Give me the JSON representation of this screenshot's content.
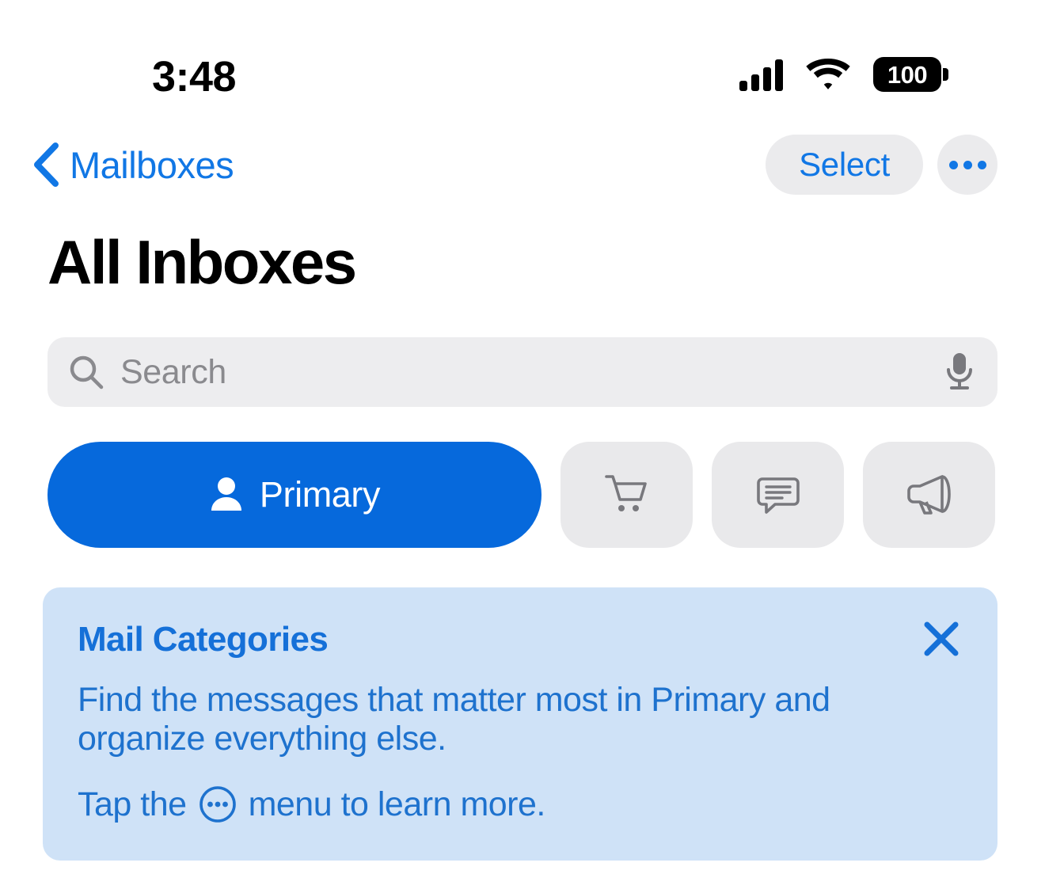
{
  "status_bar": {
    "time": "3:48",
    "battery_level": "100",
    "signal_icon": "cellular-signal-icon",
    "wifi_icon": "wifi-icon",
    "battery_icon": "battery-icon"
  },
  "nav": {
    "back_label": "Mailboxes",
    "back_icon": "chevron-left-icon",
    "select_label": "Select",
    "more_icon": "ellipsis-icon"
  },
  "header": {
    "title": "All Inboxes"
  },
  "search": {
    "placeholder": "Search",
    "value": "",
    "search_icon": "search-icon",
    "mic_icon": "microphone-icon"
  },
  "categories": [
    {
      "id": "primary",
      "label": "Primary",
      "icon": "person-icon",
      "selected": true
    },
    {
      "id": "transactions",
      "label": "",
      "icon": "shopping-cart-icon",
      "selected": false
    },
    {
      "id": "updates",
      "label": "",
      "icon": "speech-bubble-icon",
      "selected": false
    },
    {
      "id": "promotions",
      "label": "",
      "icon": "megaphone-icon",
      "selected": false
    }
  ],
  "banner": {
    "title": "Mail Categories",
    "body": "Find the messages that matter most in Primary and organize everything else.",
    "hint_before": "Tap the",
    "hint_icon": "circled-ellipsis-icon",
    "hint_after": "menu to learn more.",
    "close_icon": "close-icon"
  },
  "colors": {
    "accent_blue": "#1177E5",
    "primary_button_blue": "#0669DC",
    "banner_background": "#CFE2F7",
    "banner_text": "#1E72CE",
    "banner_title": "#1570D8",
    "chip_gray": "#E9E9EB",
    "search_gray": "#EDEDEF",
    "icon_gray": "#78787D",
    "page_background": "#FFFFFF"
  }
}
